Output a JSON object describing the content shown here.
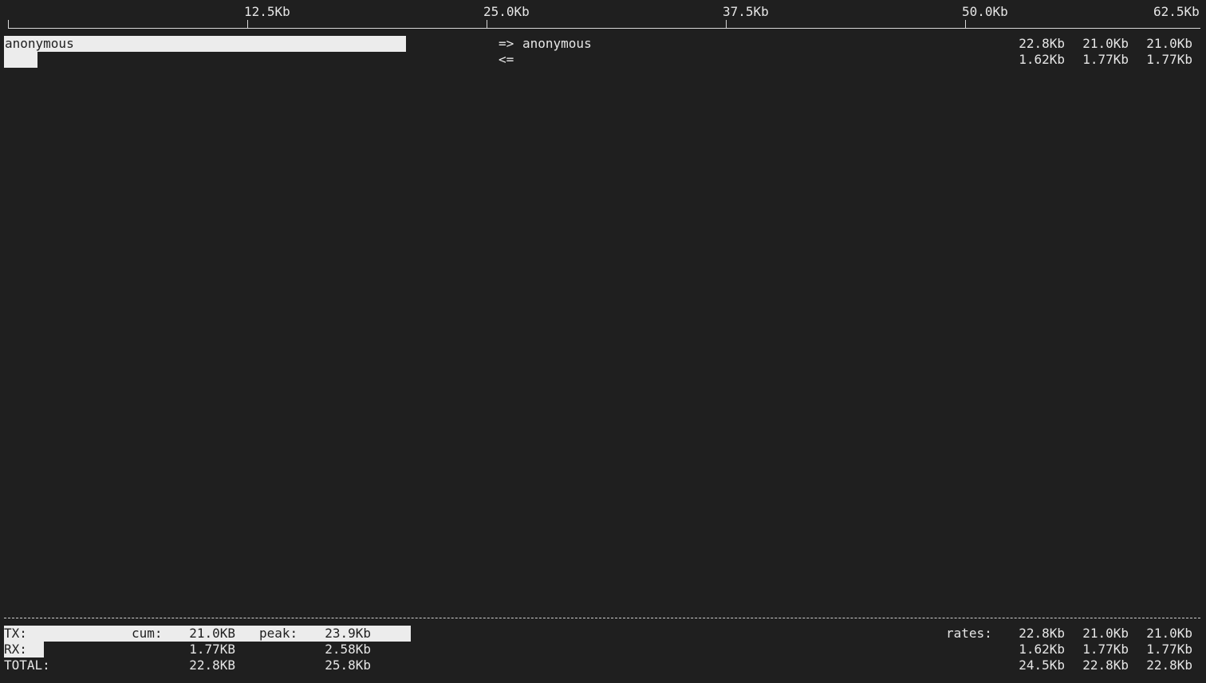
{
  "scale": {
    "ticks": [
      "12.5Kb",
      "25.0Kb",
      "37.5Kb",
      "50.0Kb",
      "62.5Kb"
    ],
    "max_kb": 62.5
  },
  "host": {
    "name": "anonymous",
    "tx_arrow": "=>",
    "rx_arrow": "<=",
    "peer": "anonymous",
    "tx_rates": [
      "22.8Kb",
      "21.0Kb",
      "21.0Kb"
    ],
    "rx_rates": [
      "1.62Kb",
      "1.77Kb",
      "1.77Kb"
    ],
    "tx_bar_kb": 21.0,
    "rx_bar_kb": 1.77
  },
  "totals": {
    "tx_label": "TX:",
    "rx_label": "RX:",
    "total_label": "TOTAL:",
    "cum_label": "cum:",
    "peak_label": "peak:",
    "rates_label": "rates:",
    "tx_cum": "21.0KB",
    "rx_cum": "1.77KB",
    "total_cum": "22.8KB",
    "tx_peak": "23.9Kb",
    "rx_peak": "2.58Kb",
    "total_peak": "25.8Kb",
    "tx_rates": [
      "22.8Kb",
      "21.0Kb",
      "21.0Kb"
    ],
    "rx_rates": [
      "1.62Kb",
      "1.77Kb",
      "1.77Kb"
    ],
    "total_rates": [
      "24.5Kb",
      "22.8Kb",
      "22.8Kb"
    ]
  },
  "colors": {
    "background": "#1f1f1f",
    "foreground": "#e6e6e6",
    "bar": "#ececec"
  }
}
